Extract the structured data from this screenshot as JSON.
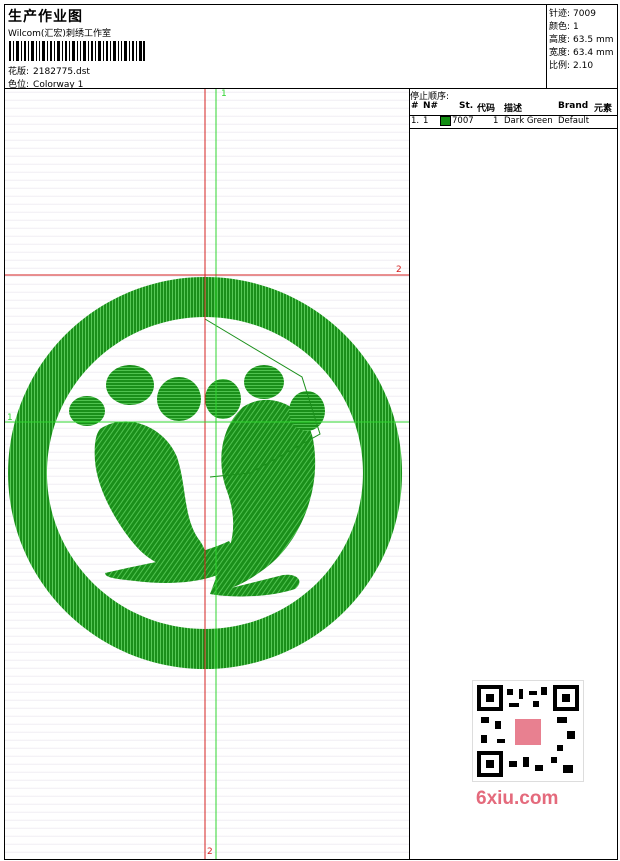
{
  "header": {
    "title": "生产作业图",
    "company": "Wilcom(汇宏)刺绣工作室",
    "design_label": "花版:",
    "design_value": "2182775.dst",
    "colorway_label": "色位:",
    "colorway_value": "Colorway 1"
  },
  "stats": {
    "stitches_label": "针迹:",
    "stitches_value": "7009",
    "colors_label": "颜色:",
    "colors_value": "1",
    "height_label": "高度:",
    "height_value": "63.5 mm",
    "width_label": "宽度:",
    "width_value": "63.4 mm",
    "scale_label": "比例:",
    "scale_value": "2.10"
  },
  "stop_sequence": {
    "title": "停止顺序:",
    "columns": [
      "#",
      "N#",
      "St.",
      "代码",
      "描述",
      "Brand",
      "元素"
    ],
    "rows": [
      {
        "index": "1.",
        "needle": "1",
        "stitches": "7007",
        "code": "1",
        "description": "Dark Green",
        "brand": "Default",
        "color": "#128c12"
      }
    ]
  },
  "guides": {
    "v_label_top": "1",
    "h_label_right": "2",
    "h_label_left": "1",
    "v_label_bottom": "2"
  },
  "colors": {
    "embroidery": "#1a8f1a",
    "guide_red": "#d42020",
    "guide_green": "#2fd42f"
  },
  "watermark": "6xiu.com"
}
